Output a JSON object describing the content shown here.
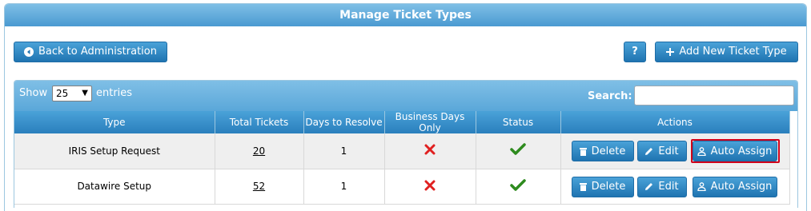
{
  "panel": {
    "title": "Manage Ticket Types"
  },
  "buttons": {
    "back_label": "Back to Administration",
    "help_label": "?",
    "add_label": "Add New Ticket Type"
  },
  "toolbar": {
    "show_label": "Show",
    "entries_select_value": "25",
    "entries_label": "entries",
    "search_label": "Search:",
    "search_value": ""
  },
  "table": {
    "columns": [
      "Type",
      "Total Tickets",
      "Days to Resolve",
      "Business Days Only",
      "Status",
      "Actions"
    ],
    "rows": [
      {
        "type": "IRIS Setup Request",
        "total_tickets": "20",
        "days_to_resolve": "1",
        "business_days_only": "no",
        "status": "active"
      },
      {
        "type": "Datawire Setup",
        "total_tickets": "52",
        "days_to_resolve": "1",
        "business_days_only": "no",
        "status": "active"
      }
    ],
    "action_labels": {
      "delete": "Delete",
      "edit": "Edit",
      "auto_assign": "Auto Assign"
    }
  },
  "icons": {
    "back": "circle-left-icon",
    "add": "plus-icon",
    "delete": "trash-icon",
    "edit": "pencil-icon",
    "auto_assign": "user-icon",
    "business_days_no": "red-x-icon",
    "status_active": "green-check-icon"
  },
  "colors": {
    "header_blue": "#4a9ad1",
    "button_blue": "#1f74b1",
    "x_red": "#e02020",
    "check_green": "#2e8b1e",
    "highlight_red": "#d0021b"
  }
}
